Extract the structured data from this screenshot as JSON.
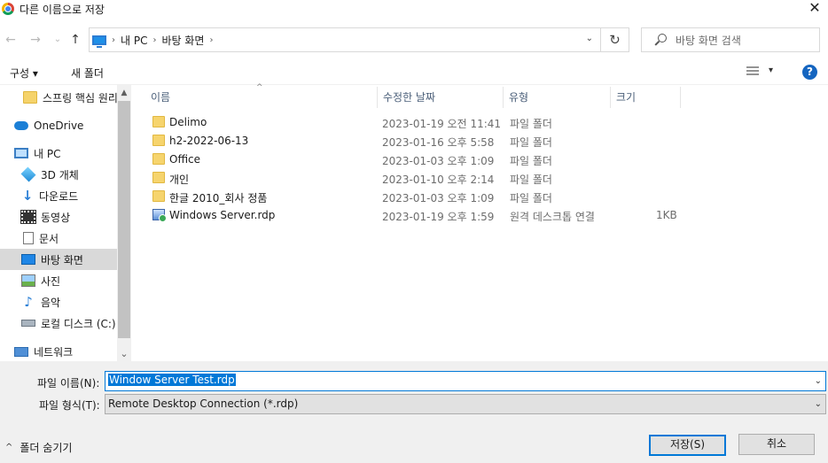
{
  "window": {
    "title": "다른 이름으로 저장",
    "close_glyph": "✕"
  },
  "nav": {
    "back": "←",
    "forward": "→",
    "recent": "⌄",
    "up": "↑",
    "breadcrumb": [
      "내 PC",
      "바탕 화면"
    ],
    "separator": "›",
    "dropdown": "⌄",
    "refresh": "↻",
    "search_placeholder": "바탕 화면 검색"
  },
  "toolbar": {
    "organize": "구성 ▾",
    "new_folder": "새 폴더",
    "view_drop": "▾",
    "help": "?"
  },
  "sidebar": {
    "items": [
      {
        "label": "스프링 핵심 원리",
        "icon": "folder-icon"
      },
      {
        "label": "OneDrive",
        "icon": "onedrive-icon"
      },
      {
        "label": "내 PC",
        "icon": "pc-icon"
      },
      {
        "label": "3D 개체",
        "icon": "3d-objects-icon"
      },
      {
        "label": "다운로드",
        "icon": "download-icon"
      },
      {
        "label": "동영상",
        "icon": "video-icon"
      },
      {
        "label": "문서",
        "icon": "document-icon"
      },
      {
        "label": "바탕 화면",
        "icon": "desktop-icon",
        "selected": true
      },
      {
        "label": "사진",
        "icon": "picture-icon"
      },
      {
        "label": "음악",
        "icon": "music-icon"
      },
      {
        "label": "로컬 디스크 (C:)",
        "icon": "disk-icon"
      },
      {
        "label": "네트워크",
        "icon": "network-icon"
      }
    ],
    "scroll_up": "▲",
    "scroll_down": "⌄"
  },
  "columns": {
    "name": "이름",
    "date": "수정한 날짜",
    "type": "유형",
    "size": "크기",
    "sort_glyph": "^"
  },
  "files": [
    {
      "name": "Delimo",
      "date": "2023-01-19 오전 11:41",
      "type": "파일 폴더",
      "size": "",
      "icon": "folder-icon"
    },
    {
      "name": "h2-2022-06-13",
      "date": "2023-01-16 오후 5:58",
      "type": "파일 폴더",
      "size": "",
      "icon": "folder-icon"
    },
    {
      "name": "Office",
      "date": "2023-01-03 오후 1:09",
      "type": "파일 폴더",
      "size": "",
      "icon": "folder-icon"
    },
    {
      "name": "개인",
      "date": "2023-01-10 오후 2:14",
      "type": "파일 폴더",
      "size": "",
      "icon": "folder-icon"
    },
    {
      "name": "한글 2010_회사 정품",
      "date": "2023-01-03 오후 1:09",
      "type": "파일 폴더",
      "size": "",
      "icon": "folder-icon"
    },
    {
      "name": "Windows Server.rdp",
      "date": "2023-01-19 오후 1:59",
      "type": "원격 데스크톱 연결",
      "size": "1KB",
      "icon": "rdp-file-icon"
    }
  ],
  "form": {
    "filename_label": "파일 이름(N):",
    "filename_value": "Window Server Test.rdp",
    "filetype_label": "파일 형식(T):",
    "filetype_value": "Remote Desktop Connection (*.rdp)",
    "hide_folders": "폴더 숨기기",
    "hide_glyph": "^",
    "save": "저장(S)",
    "cancel": "취소",
    "combo_glyph": "⌄"
  }
}
